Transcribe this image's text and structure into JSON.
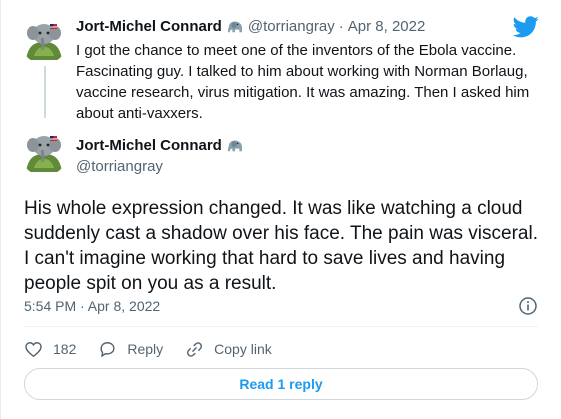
{
  "parent_tweet": {
    "author_name": "Jort-Michel Connard",
    "handle": "@torriangray",
    "separator": "·",
    "date": "Apr 8, 2022",
    "text": "I got the chance to meet one of the inventors of the Ebola vaccine. Fascinating guy. I talked to him about working with Norman Borlaug, vaccine research, virus mitigation. It was amazing. Then I asked him about anti-vaxxers."
  },
  "main_tweet": {
    "author_name": "Jort-Michel Connard",
    "handle": "@torriangray",
    "text": "His whole expression changed. It was like watching a cloud suddenly cast a shadow over his face. The pain was visceral. I can't imagine working that hard to save lives and having people spit on you as a result.",
    "timestamp": "5:54 PM · Apr 8, 2022"
  },
  "actions": {
    "like_count": "182",
    "reply_label": "Reply",
    "copy_link_label": "Copy link"
  },
  "read_replies_label": "Read 1 reply",
  "icons": {
    "logo": "twitter-bird-icon",
    "emoji": "elephant-emoji",
    "info": "info-icon",
    "like": "heart-icon",
    "reply": "reply-bubble-icon",
    "copy": "link-icon"
  },
  "colors": {
    "brand": "#1d9bf0",
    "text": "#0f1419",
    "muted": "#536471",
    "border": "#cfd9de"
  }
}
